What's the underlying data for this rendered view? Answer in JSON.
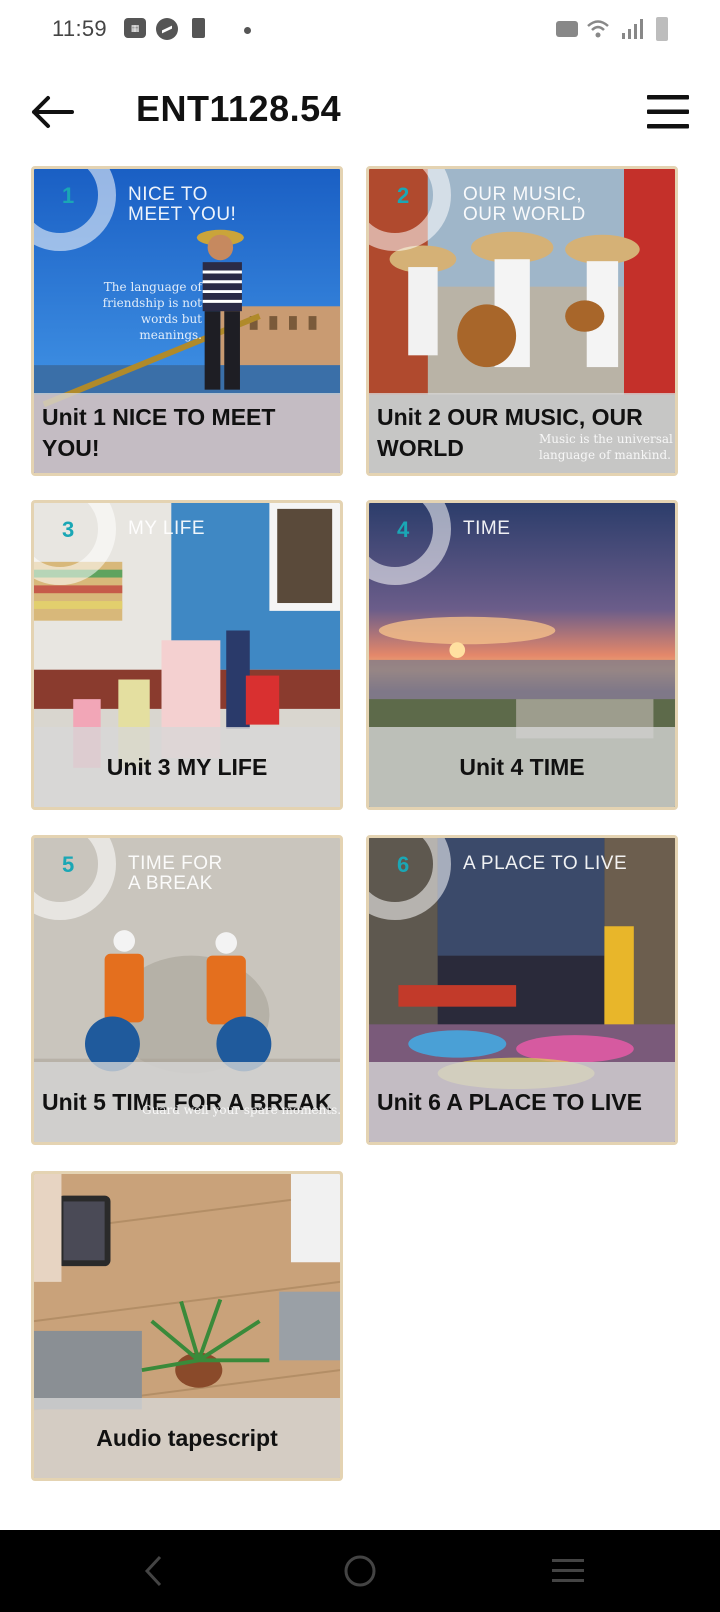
{
  "status_bar": {
    "time": "11:59",
    "sim_icon": "sim-card-icon",
    "messenger_icon": "messenger-icon",
    "battery_saver_icon": "battery-icon",
    "vibrate_icon": "vibrate-icon",
    "wifi_icon": "wifi-icon",
    "signal_icon": "signal-icon",
    "battery_icon": "battery-icon"
  },
  "app_bar": {
    "title": "ENT1128.54",
    "back_icon": "arrow-left-icon",
    "menu_icon": "hamburger-menu-icon"
  },
  "units": [
    {
      "number": "1",
      "cover_title": "NICE TO\nMEET YOU!",
      "cover_quote": "The language of\nfriendship is not\nwords but meanings.",
      "label": "Unit 1 NICE TO MEET YOU!"
    },
    {
      "number": "2",
      "cover_title": "OUR MUSIC,\nOUR WORLD",
      "cover_quote": "Music is the universal\nlanguage of mankind.",
      "label": "Unit 2 OUR MUSIC, OUR WORLD"
    },
    {
      "number": "3",
      "cover_title": "MY LIFE",
      "cover_quote": "",
      "label": "Unit 3 MY LIFE"
    },
    {
      "number": "4",
      "cover_title": "TIME",
      "cover_quote": "",
      "label": "Unit 4 TIME"
    },
    {
      "number": "5",
      "cover_title": "TIME FOR\nA BREAK",
      "cover_quote": "Guard well your spare moments.",
      "label": "Unit 5 TIME FOR A BREAK"
    },
    {
      "number": "6",
      "cover_title": "A PLACE TO LIVE",
      "cover_quote": "",
      "label": "Unit 6 A PLACE TO LIVE"
    }
  ],
  "extra": {
    "label": "Audio tapescript"
  },
  "nav_bar": {
    "back_icon": "nav-back-icon",
    "home_icon": "nav-home-icon",
    "recents_icon": "nav-recents-icon"
  },
  "colors": {
    "card_border": "#e4d3b2",
    "badge_number": "#1aa7b5",
    "caption_bg": "#d7d7d7"
  }
}
